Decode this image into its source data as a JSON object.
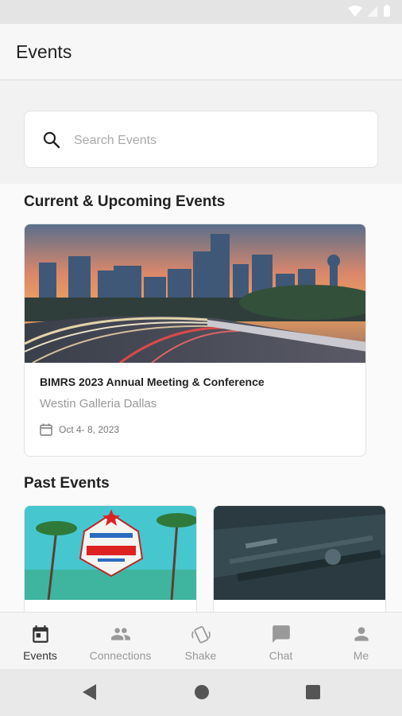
{
  "header": {
    "title": "Events"
  },
  "search": {
    "placeholder": "Search Events"
  },
  "sections": {
    "current_title": "Current & Upcoming Events",
    "past_title": "Past Events"
  },
  "current_events": [
    {
      "title": "BIMRS 2023 Annual Meeting & Conference",
      "venue": "Westin Galleria Dallas",
      "date": "Oct  4- 8, 2023"
    }
  ],
  "bottom_nav": {
    "items": [
      {
        "label": "Events",
        "icon": "calendar-icon",
        "active": true
      },
      {
        "label": "Connections",
        "icon": "people-icon",
        "active": false
      },
      {
        "label": "Shake",
        "icon": "shake-phone-icon",
        "active": false
      },
      {
        "label": "Chat",
        "icon": "chat-icon",
        "active": false
      },
      {
        "label": "Me",
        "icon": "person-icon",
        "active": false
      }
    ]
  },
  "colors": {
    "active": "#333333",
    "inactive": "#999999"
  }
}
